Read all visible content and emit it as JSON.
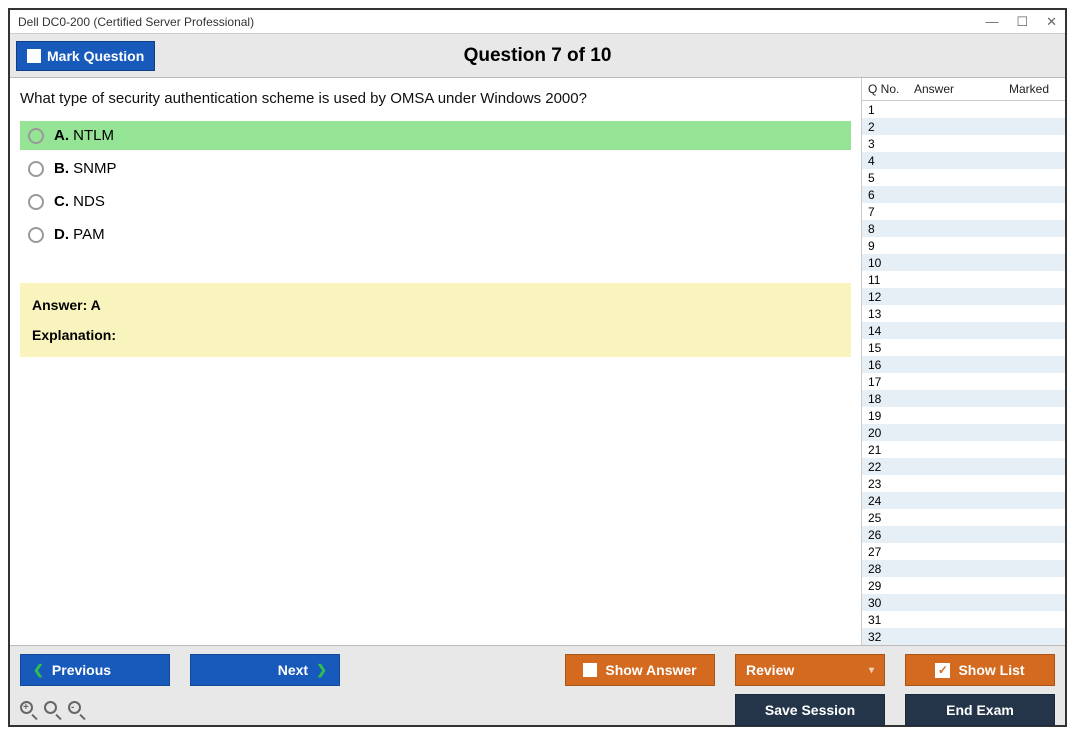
{
  "window": {
    "title": "Dell DC0-200 (Certified Server Professional)"
  },
  "header": {
    "mark_label": "Mark Question",
    "title": "Question 7 of 10"
  },
  "question": {
    "text": "What type of security authentication scheme is used by OMSA under Windows 2000?"
  },
  "options": [
    {
      "letter": "A.",
      "text": "NTLM",
      "correct": true
    },
    {
      "letter": "B.",
      "text": "SNMP",
      "correct": false
    },
    {
      "letter": "C.",
      "text": "NDS",
      "correct": false
    },
    {
      "letter": "D.",
      "text": "PAM",
      "correct": false
    }
  ],
  "answer_box": {
    "answer_label": "Answer: A",
    "explanation_label": "Explanation:"
  },
  "sidebar": {
    "headers": {
      "qno": "Q No.",
      "answer": "Answer",
      "marked": "Marked"
    },
    "rows": 33
  },
  "footer": {
    "previous": "Previous",
    "next": "Next",
    "show_answer": "Show Answer",
    "review": "Review",
    "show_list": "Show List",
    "save_session": "Save Session",
    "end_exam": "End Exam"
  }
}
